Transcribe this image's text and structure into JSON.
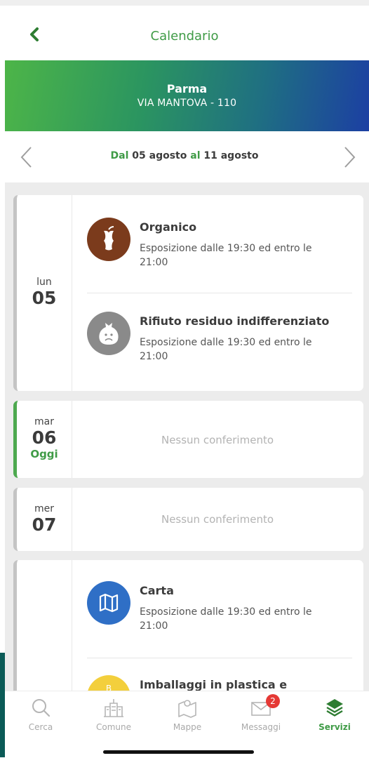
{
  "header": {
    "title": "Calendario"
  },
  "location": {
    "city": "Parma",
    "street": "VIA MANTOVA - 110"
  },
  "week": {
    "from_word": "Dal",
    "from_date": "05 agosto",
    "to_word": "al",
    "to_date": "11 agosto"
  },
  "days": [
    {
      "dow": "lun",
      "num": "05",
      "today_label": "",
      "items": [
        {
          "title": "Organico",
          "desc": "Esposizione dalle 19:30 ed entro le 21:00",
          "color": "#7b3b1c",
          "icon": "apple-core-icon"
        },
        {
          "title": "Rifiuto residuo indifferenziato",
          "desc": "Esposizione dalle 19:30 ed entro le 21:00",
          "color": "#8a8a8a",
          "icon": "trash-bag-icon"
        }
      ]
    },
    {
      "dow": "mar",
      "num": "06",
      "today_label": "Oggi",
      "empty": "Nessun conferimento"
    },
    {
      "dow": "mer",
      "num": "07",
      "empty": "Nessun conferimento"
    },
    {
      "dow": "",
      "num": "",
      "items": [
        {
          "title": "Carta",
          "desc": "Esposizione dalle 19:30 ed entro le 21:00",
          "color": "#2f6fc6",
          "icon": "map-paper-icon"
        },
        {
          "title": "Imballaggi in plastica e",
          "desc": "",
          "color": "#f3cf3c",
          "icon": "plastic-icon",
          "icon_letter": "B"
        }
      ]
    }
  ],
  "tabs": [
    {
      "label": "Cerca",
      "icon": "search-icon"
    },
    {
      "label": "Comune",
      "icon": "building-icon"
    },
    {
      "label": "Mappe",
      "icon": "map-icon"
    },
    {
      "label": "Messaggi",
      "icon": "envelope-icon",
      "badge": "2"
    },
    {
      "label": "Servizi",
      "icon": "layers-icon",
      "active": true
    }
  ],
  "colors": {
    "accent": "#3f9b46",
    "badge": "#e53935"
  }
}
